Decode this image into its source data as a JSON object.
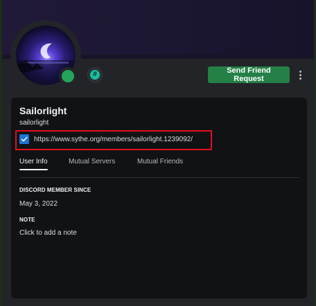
{
  "profile": {
    "display_name": "Sailorlight",
    "username": "sailorlight",
    "custom_status": "https://www.sythe.org/members/sailorlight.1239092/",
    "status_icon": "checkbox-checked-icon",
    "presence": "online",
    "badge_icon": "hashtag-badge-icon",
    "badge_text": "#"
  },
  "actions": {
    "friend_request_label": "Send Friend Request",
    "more_icon": "more-vertical-icon"
  },
  "tabs": [
    {
      "label": "User Info",
      "active": true
    },
    {
      "label": "Mutual Servers",
      "active": false
    },
    {
      "label": "Mutual Friends",
      "active": false
    }
  ],
  "info": {
    "member_since_label": "DISCORD MEMBER SINCE",
    "member_since_value": "May 3, 2022",
    "note_label": "NOTE",
    "note_placeholder": "Click to add a note"
  },
  "colors": {
    "accent_button": "#248046",
    "online": "#23a55a",
    "highlight_box": "#e0101d",
    "checkbox": "#1d74d6"
  }
}
